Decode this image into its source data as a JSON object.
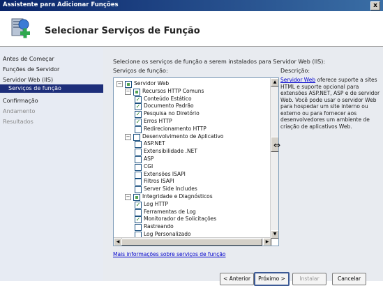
{
  "window": {
    "title": "Assistente para Adicionar Funções",
    "close_glyph": "x"
  },
  "header": {
    "title": "Selecionar Serviços de Função",
    "icon": "server-roles-wizard-icon"
  },
  "nav": {
    "items": [
      {
        "label": "Antes de Começar",
        "state": "normal"
      },
      {
        "label": "Funções de Servidor",
        "state": "normal"
      },
      {
        "label": "Servidor Web (IIS)",
        "state": "normal"
      },
      {
        "label": "Serviços de função",
        "state": "selected"
      },
      {
        "label": "Confirmação",
        "state": "normal"
      },
      {
        "label": "Andamento",
        "state": "disabled"
      },
      {
        "label": "Resultados",
        "state": "disabled"
      }
    ]
  },
  "main": {
    "instruction": "Selecione os serviços de função a serem instalados para Servidor Web (IIS):",
    "services_label": "Serviços de função:",
    "description_label": "Descrição:",
    "description_link": "Servidor Web",
    "description_text": " oferece suporte a sites HTML e suporte opcional para extensões ASP.NET, ASP e de servidor Web. Você pode usar o servidor Web para hospedar um site interno ou externo ou para fornecer aos desenvolvedores um ambiente de criação de aplicativos Web.",
    "more_link": "Mais informações sobre serviços de função"
  },
  "tree": [
    {
      "label": "Servidor Web",
      "level": 0,
      "expander": "−",
      "check": "partial"
    },
    {
      "label": "Recursos HTTP Comuns",
      "level": 1,
      "expander": "−",
      "check": "partial"
    },
    {
      "label": "Conteúdo Estático",
      "level": 2,
      "check": "checked"
    },
    {
      "label": "Documento Padrão",
      "level": 2,
      "check": "checked"
    },
    {
      "label": "Pesquisa no Diretório",
      "level": 2,
      "check": "checked"
    },
    {
      "label": "Erros HTTP",
      "level": 2,
      "check": "checked"
    },
    {
      "label": "Redirecionamento HTTP",
      "level": 2,
      "check": "unchecked"
    },
    {
      "label": "Desenvolvimento de Aplicativo",
      "level": 1,
      "expander": "−",
      "check": "unchecked"
    },
    {
      "label": "ASP.NET",
      "level": 2,
      "check": "unchecked"
    },
    {
      "label": "Extensibilidade .NET",
      "level": 2,
      "check": "unchecked"
    },
    {
      "label": "ASP",
      "level": 2,
      "check": "unchecked"
    },
    {
      "label": "CGI",
      "level": 2,
      "check": "unchecked"
    },
    {
      "label": "Extensões ISAPI",
      "level": 2,
      "check": "unchecked"
    },
    {
      "label": "Filtros ISAPI",
      "level": 2,
      "check": "unchecked"
    },
    {
      "label": "Server Side Includes",
      "level": 2,
      "check": "unchecked"
    },
    {
      "label": "Integridade e Diagnósticos",
      "level": 1,
      "expander": "−",
      "check": "partial"
    },
    {
      "label": "Log HTTP",
      "level": 2,
      "check": "checked"
    },
    {
      "label": "Ferramentas de Log",
      "level": 2,
      "check": "unchecked"
    },
    {
      "label": "Monitorador de Solicitações",
      "level": 2,
      "check": "checked"
    },
    {
      "label": "Rastreando",
      "level": 2,
      "check": "unchecked"
    },
    {
      "label": "Log Personalizado",
      "level": 2,
      "check": "unchecked"
    }
  ],
  "buttons": {
    "previous": "< Anterior",
    "next": "Próximo >",
    "install": "Instalar",
    "cancel": "Cancelar"
  }
}
